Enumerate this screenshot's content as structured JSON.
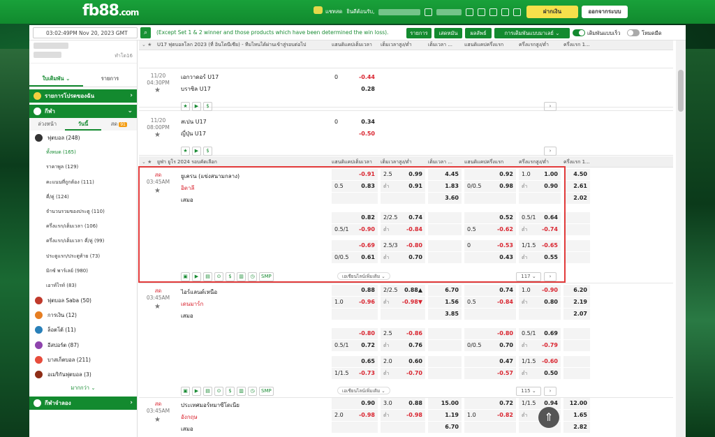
{
  "header": {
    "logo": "fb88",
    "logo_suffix": ".com",
    "chat": "แชทสด",
    "welcome": "ยินดีต้อนรับ,",
    "deposit": "ฝากเงิน",
    "logout": "ออกจากระบบ",
    "brand_color": "#138a2f"
  },
  "filter": {
    "datetime": "03:02:49PM Nov 20, 2023 GMT +8",
    "notice": "(Except Set 1 & 2 winner and those products which have been determined the win loss).",
    "btn_list": "รายการ",
    "btn_start": "เสดหมัน",
    "btn_result": "ผลลัพธ์",
    "btn_bettype": "การเดิมพันแบบมาเลย์ ⌄",
    "quick_bet": "เดิมพันแบบเร็ว",
    "dark_mode": "โหมดมืด"
  },
  "sidebar": {
    "acct_line": "ทำโต16",
    "tab_betslip": "ใบเดิมพัน ⌄",
    "tab_list": "รายการ",
    "favorites": "รายการโปรดของฉัน",
    "sports": "กีฬา",
    "sub_early": "ล่วงหน้า",
    "sub_today": "วันนี้",
    "sub_live": "สด",
    "live_count": "91",
    "football": "ฟุตบอล (248)",
    "football_subs": [
      {
        "label": "ทั้งหมด (165)"
      },
      {
        "label": "ราคาพูล (129)"
      },
      {
        "label": "คะแนนที่ถูกต้อง (111)"
      },
      {
        "label": "คี่/คู่ (124)"
      },
      {
        "label": "จำนวนรวมของประตู (110)"
      },
      {
        "label": "ครึ่งแรก/เต็มเวลา (106)"
      },
      {
        "label": "ครึ่งแรก/เต็มเวลา คี่/คู่ (99)"
      },
      {
        "label": "ประตูแรก/ประตูท้าย (73)"
      },
      {
        "label": "มิกซ์ พาร์เลย์ (980)"
      },
      {
        "label": "เอาท์ไรท์ (83)"
      }
    ],
    "others": [
      {
        "label": "ฟุตบอล Saba (50)"
      },
      {
        "label": "การเงิน (12)"
      },
      {
        "label": "ล็อตโต้ (11)"
      },
      {
        "label": "อีสปอร์ต (87)"
      },
      {
        "label": "บาสเก็ตบอล (211)"
      },
      {
        "label": "อเมริกันฟุตบอล (3)"
      }
    ],
    "more": "มากกว่า ⌄",
    "sports_cross": "กีฬาจำลอง"
  },
  "leagues": [
    {
      "name": "U17 ฟุตบอลโลก 2023 (ที่ อินโดนีเซีย) - ทีมไหนได้ผ่านเข้าสู่รอบต่อไป",
      "cols": [
        "แฮนดิแคปเต็มเวลา",
        "เต็มเวลาสูง/ต่ำ",
        "เต็มเวลา ...",
        "แฮนดิแคปครึ่งแรก",
        "ครึ่งแรกสูง/ต่ำ",
        "ครึ่งแรก 1..."
      ]
    },
    {
      "name": "ยูฟ่า ยูโร 2024 รอบคัดเลือก",
      "cols": [
        "แฮนดิแคปเต็มเวลา",
        "เต็มเวลาสูง/ต่ำ",
        "เต็มเวลา ...",
        "แฮนดิแคปครึ่งแรก",
        "ครึ่งแรกสูง/ต่ำ",
        "ครึ่งแรก 1..."
      ]
    }
  ],
  "matches": [
    {
      "date": "11/20",
      "time": "04:30PM",
      "home": "เอกวาดอร์ U17",
      "away": "บราซิล U17",
      "rows": [
        {
          "hdp": "0",
          "hdp_o": "-0.44"
        },
        {
          "hdp": "",
          "hdp_o": "0.28"
        }
      ]
    },
    {
      "date": "11/20",
      "time": "08:00PM",
      "home": "สเปน U17",
      "away": "ญี่ปุ่น U17",
      "rows": [
        {
          "hdp": "0",
          "hdp_o": "0.34"
        },
        {
          "hdp": "",
          "hdp_o": "-0.50"
        }
      ]
    },
    {
      "live": "สด",
      "time": "03:45AM",
      "home": "ยูเครน (แข่งสนามกลาง)",
      "away": "อิตาลี",
      "draw": "เสมอ",
      "page": "117 ⌄"
    },
    {
      "live": "สด",
      "time": "03:45AM",
      "home": "ไอร์แลนด์เหนือ",
      "away": "เดนมาร์ก",
      "draw": "เสมอ",
      "page": "115 ⌄"
    },
    {
      "live": "สด",
      "time": "03:45AM",
      "home": "ประเทศมอร์ทมาซีโดเนีย",
      "away": "อังกฤษ",
      "draw": "เสมอ"
    }
  ],
  "odds_m3": [
    [
      "",
      "-0.91",
      "2.5",
      "0.99",
      "4.45",
      "",
      "0.92",
      "1.0",
      "1.00",
      "4.50"
    ],
    [
      "0.5",
      "0.83",
      "ต่ำ",
      "0.91",
      "1.83",
      "0/0.5",
      "0.98",
      "ต่ำ",
      "0.90",
      "2.61"
    ],
    [
      "",
      "",
      "",
      "",
      "3.60",
      "",
      "",
      "",
      "",
      "2.02"
    ],
    [
      "",
      "0.82",
      "2/2.5",
      "0.74",
      "",
      "",
      "0.52",
      "0.5/1",
      "0.64",
      ""
    ],
    [
      "0.5/1",
      "-0.90",
      "ต่ำ",
      "-0.84",
      "",
      "0.5",
      "-0.62",
      "ต่ำ",
      "-0.74",
      ""
    ],
    [
      "",
      "-0.69",
      "2.5/3",
      "-0.80",
      "",
      "0",
      "-0.53",
      "1/1.5",
      "-0.65",
      ""
    ],
    [
      "0/0.5",
      "0.61",
      "ต่ำ",
      "0.70",
      "",
      "",
      "0.43",
      "ต่ำ",
      "0.55",
      ""
    ]
  ],
  "odds_m4": [
    [
      "",
      "0.88",
      "2/2.5",
      "0.88▲",
      "6.70",
      "",
      "0.74",
      "1.0",
      "-0.90",
      "6.20"
    ],
    [
      "1.0",
      "-0.96",
      "ต่ำ",
      "-0.98▼",
      "1.56",
      "0.5",
      "-0.84",
      "ต่ำ",
      "0.80",
      "2.19"
    ],
    [
      "",
      "",
      "",
      "",
      "3.85",
      "",
      "",
      "",
      "",
      "2.07"
    ],
    [
      "",
      "-0.80",
      "2.5",
      "-0.86",
      "",
      "",
      "-0.80",
      "0.5/1",
      "0.69",
      ""
    ],
    [
      "0.5/1",
      "0.72",
      "ต่ำ",
      "0.76",
      "",
      "0/0.5",
      "0.70",
      "ต่ำ",
      "-0.79",
      ""
    ],
    [
      "",
      "0.65",
      "2.0",
      "0.60",
      "",
      "",
      "0.47",
      "1/1.5",
      "-0.60",
      ""
    ],
    [
      "1/1.5",
      "-0.73",
      "ต่ำ",
      "-0.70",
      "",
      "",
      "-0.57",
      "ต่ำ",
      "0.50",
      ""
    ]
  ],
  "odds_m5": [
    [
      "",
      "0.90",
      "3.0",
      "0.88",
      "15.00",
      "",
      "0.72",
      "1/1.5",
      "0.94",
      "12.00"
    ],
    [
      "2.0",
      "-0.98",
      "ต่ำ",
      "-0.98",
      "1.19",
      "1.0",
      "-0.82",
      "ต่ำ",
      "0.96",
      "1.65"
    ],
    [
      "",
      "",
      "",
      "",
      "6.70",
      "",
      "",
      "",
      "",
      "2.82"
    ]
  ],
  "more_odds": "เอเชียนไลน์เพิ่มเติม ⌄",
  "smp": "SMP",
  "to_top_icon": "arrow-up"
}
